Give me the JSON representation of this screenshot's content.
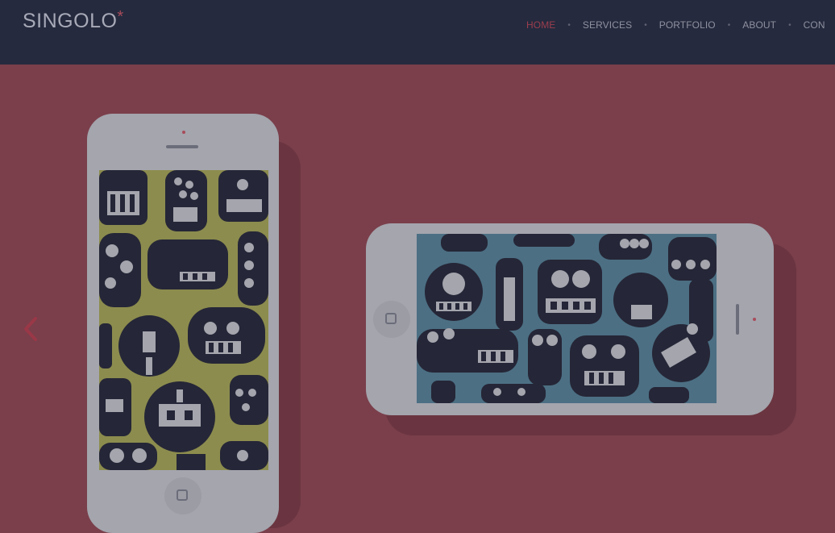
{
  "header": {
    "logo_text": "SINGOLO",
    "logo_mark": "*",
    "nav": [
      {
        "label": "HOME",
        "active": true
      },
      {
        "label": "SERVICES",
        "active": false
      },
      {
        "label": "PORTFOLIO",
        "active": false
      },
      {
        "label": "ABOUT",
        "active": false
      },
      {
        "label": "CON",
        "active": false
      }
    ]
  },
  "slider": {
    "prev_icon": "chevron-left-icon",
    "vertical_screen_color": "#8c8c4e",
    "horizontal_screen_color": "#4c6f83"
  },
  "colors": {
    "header_bg": "#252a3e",
    "slide_bg": "#7a3f4b",
    "accent": "#a84b5a",
    "phone_body": "#a4a5ad",
    "monster": "#252637"
  }
}
